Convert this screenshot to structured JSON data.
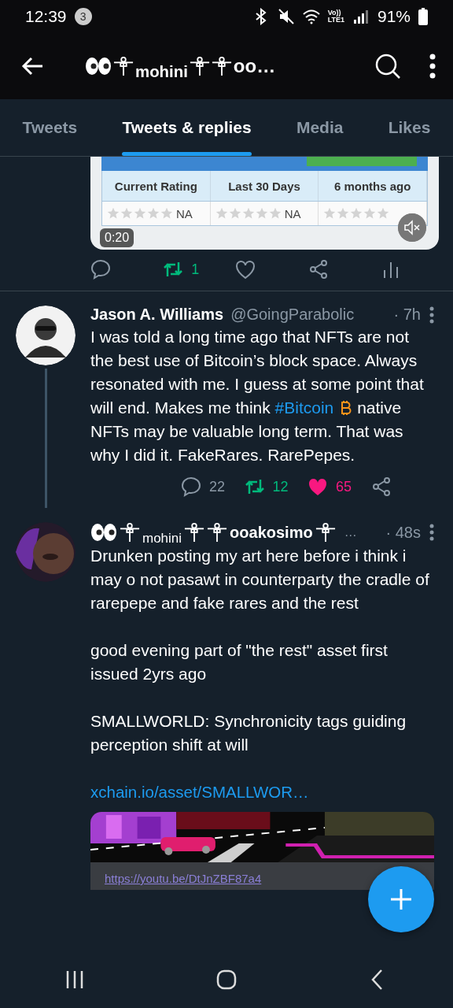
{
  "status_bar": {
    "time": "12:39",
    "notification_count": "3",
    "network_top": "Vo))",
    "network_bottom": "LTE1",
    "battery": "91%"
  },
  "header": {
    "title_parts": [
      {
        "kind": "eyes"
      },
      {
        "kind": "cross"
      },
      {
        "kind": "lowered",
        "text": "mohini"
      },
      {
        "kind": "cross"
      },
      {
        "kind": "cross"
      },
      {
        "kind": "text",
        "text": "oo…"
      }
    ]
  },
  "tabs": [
    {
      "label": "Tweets",
      "selected": false
    },
    {
      "label": "Tweets & replies",
      "selected": true
    },
    {
      "label": "Media",
      "selected": false
    },
    {
      "label": "Likes",
      "selected": false
    }
  ],
  "tweets": [
    {
      "kind": "media_tail",
      "video": {
        "columns": [
          "Current Rating",
          "Last 30 Days",
          "6 months ago"
        ],
        "ratings": [
          {
            "stars": 0,
            "text": "NA"
          },
          {
            "stars": 0,
            "text": "NA"
          },
          {
            "stars": 0
          }
        ],
        "duration": "0:20",
        "muted": true
      },
      "actions": [
        {
          "kind": "reply"
        },
        {
          "kind": "retweet",
          "count": "1",
          "active": true
        },
        {
          "kind": "like",
          "active": false
        },
        {
          "kind": "share"
        },
        {
          "kind": "analytics"
        }
      ]
    },
    {
      "kind": "tweet",
      "avatar": {
        "kind": "picture"
      },
      "thread_line": true,
      "name_parts": [
        {
          "kind": "text",
          "text": "Jason A. Williams"
        }
      ],
      "handle": "@GoingParabolic",
      "time": "· 7h",
      "body": [
        {
          "kind": "text",
          "text": "I was told a long time ago that NFTs are not the best use of Bitcoin’s block space. Always resonated with me. I guess at some point that will end.  Makes me think "
        },
        {
          "kind": "hashtag",
          "text": "#Bitcoin"
        },
        {
          "kind": "bitcoin"
        },
        {
          "kind": "text",
          "text": "  native NFTs may be valuable long term.  That was why I did it. FakeRares. RarePepes."
        }
      ],
      "actions": [
        {
          "kind": "reply",
          "count": "22"
        },
        {
          "kind": "retweet",
          "count": "12",
          "active": true
        },
        {
          "kind": "like",
          "count": "65",
          "active": true
        },
        {
          "kind": "share"
        }
      ]
    },
    {
      "kind": "tweet",
      "avatar": {
        "kind": "picture"
      },
      "name_parts": [
        {
          "kind": "eyes"
        },
        {
          "kind": "cross"
        },
        {
          "kind": "lowered",
          "text": "mohini"
        },
        {
          "kind": "cross"
        },
        {
          "kind": "cross"
        },
        {
          "kind": "text",
          "text": "ooakosimo"
        },
        {
          "kind": "cross"
        },
        {
          "kind": "muted",
          "text": "…"
        }
      ],
      "time": "· 48s",
      "paragraphs": [
        "Drunken posting my art here before i think i may o not pasawt in counterparty the cradle of rarepepe and fake rares and the rest",
        "good evening part of \"the rest\" asset first issued 2yrs ago",
        "SMALLWORLD: Synchronicity tags guiding perception shift at will"
      ],
      "link": "xchain.io/asset/SMALLWOR…",
      "preview": {
        "url": "https://youtu.be/DtJnZBF87a4"
      }
    }
  ]
}
